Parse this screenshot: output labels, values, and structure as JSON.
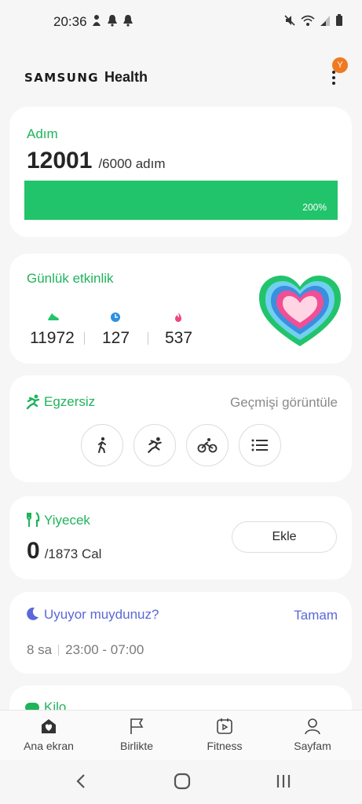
{
  "status_bar": {
    "time": "20:36"
  },
  "header": {
    "brand_primary": "SAMSUNG",
    "brand_secondary": "Health",
    "badge": "Y"
  },
  "steps_card": {
    "title": "Adım",
    "value": "12001",
    "goal": "/6000 adım",
    "percent_label": "200%",
    "progress_fraction": 1.0,
    "color": "#22c46b"
  },
  "activity_card": {
    "title": "Günlük etkinlik",
    "stats": [
      {
        "icon": "shoe-icon",
        "value": "11972",
        "color": "#22c46b"
      },
      {
        "icon": "clock-icon",
        "value": "127",
        "color": "#2f8fe0"
      },
      {
        "icon": "flame-icon",
        "value": "537",
        "color": "#f0457f"
      }
    ]
  },
  "exercise_card": {
    "title": "Egzersiz",
    "history_link": "Geçmişi görüntüle",
    "buttons": [
      "walking-icon",
      "running-icon",
      "cycling-icon",
      "list-icon"
    ]
  },
  "food_card": {
    "title": "Yiyecek",
    "value": "0",
    "goal": "/1873 Cal",
    "add_label": "Ekle"
  },
  "sleep_card": {
    "title": "Uyuyor muydunuz?",
    "done_label": "Tamam",
    "duration": "8 sa",
    "range": "23:00 - 07:00"
  },
  "weight_card": {
    "title": "Kilo"
  },
  "bottom_nav": {
    "items": [
      {
        "label": "Ana ekran",
        "icon": "home-icon"
      },
      {
        "label": "Birlikte",
        "icon": "flag-icon"
      },
      {
        "label": "Fitness",
        "icon": "fitness-icon"
      },
      {
        "label": "Sayfam",
        "icon": "person-icon"
      }
    ]
  },
  "colors": {
    "accent_green": "#1fb35b",
    "sleep_blue": "#5a68d8",
    "badge_orange": "#f07a22"
  }
}
